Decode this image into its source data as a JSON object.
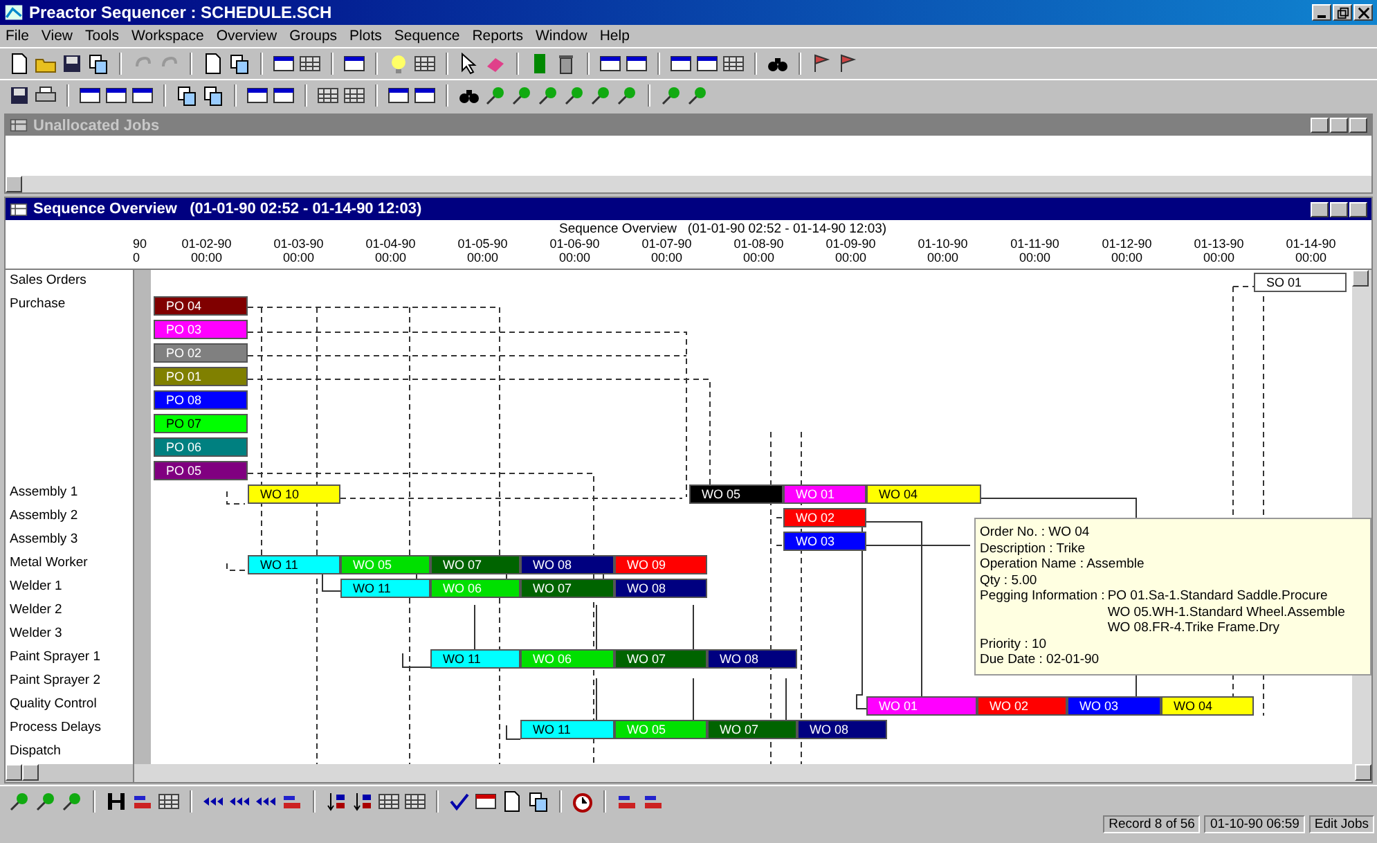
{
  "window": {
    "title": "Preactor Sequencer : SCHEDULE.SCH"
  },
  "menu": [
    "File",
    "View",
    "Tools",
    "Workspace",
    "Overview",
    "Groups",
    "Plots",
    "Sequence",
    "Reports",
    "Window",
    "Help"
  ],
  "unallocated": {
    "title": "Unallocated Jobs"
  },
  "overview": {
    "title": "Sequence Overview   (01-01-90 02:52 - 01-14-90 12:03)",
    "header": "Sequence Overview   (01-01-90 02:52 - 01-14-90 12:03)",
    "ticks": [
      {
        "date": "90",
        "time": "0"
      },
      {
        "date": "01-02-90",
        "time": "00:00"
      },
      {
        "date": "01-03-90",
        "time": "00:00"
      },
      {
        "date": "01-04-90",
        "time": "00:00"
      },
      {
        "date": "01-05-90",
        "time": "00:00"
      },
      {
        "date": "01-06-90",
        "time": "00:00"
      },
      {
        "date": "01-07-90",
        "time": "00:00"
      },
      {
        "date": "01-08-90",
        "time": "00:00"
      },
      {
        "date": "01-09-90",
        "time": "00:00"
      },
      {
        "date": "01-10-90",
        "time": "00:00"
      },
      {
        "date": "01-11-90",
        "time": "00:00"
      },
      {
        "date": "01-12-90",
        "time": "00:00"
      },
      {
        "date": "01-13-90",
        "time": "00:00"
      },
      {
        "date": "01-14-90",
        "time": "00:00"
      }
    ],
    "lanes": [
      {
        "label": "Sales Orders",
        "bars": [
          {
            "label": "SO 01",
            "color": "#ffffff"
          }
        ]
      },
      {
        "label": "Purchase",
        "bars": [
          {
            "label": "PO 04",
            "color": "#800000"
          },
          {
            "label": "PO 03",
            "color": "#ff00ff"
          },
          {
            "label": "PO 02",
            "color": "#808080"
          },
          {
            "label": "PO 01",
            "color": "#808000"
          },
          {
            "label": "PO 08",
            "color": "#0000ff"
          },
          {
            "label": "PO 07",
            "color": "#00ff00"
          },
          {
            "label": "PO 06",
            "color": "#008080"
          },
          {
            "label": "PO 05",
            "color": "#800080"
          }
        ]
      },
      {
        "label": "Assembly 1",
        "bars": [
          {
            "label": "WO 10",
            "color": "#ffff00"
          },
          {
            "label": "WO 05",
            "color": "#000000"
          },
          {
            "label": "WO 01",
            "color": "#ff00ff"
          },
          {
            "label": "WO 04",
            "color": "#ffff00"
          }
        ]
      },
      {
        "label": "Assembly 2",
        "bars": [
          {
            "label": "WO 02",
            "color": "#ff0000"
          }
        ]
      },
      {
        "label": "Assembly 3",
        "bars": [
          {
            "label": "WO 03",
            "color": "#0000ff"
          }
        ]
      },
      {
        "label": "Metal Worker",
        "bars": [
          {
            "label": "WO 11",
            "color": "#00ffff"
          },
          {
            "label": "WO 05",
            "color": "#00e000"
          },
          {
            "label": "WO 07",
            "color": "#006400"
          },
          {
            "label": "WO 08",
            "color": "#000080"
          },
          {
            "label": "WO 09",
            "color": "#ff0000"
          }
        ]
      },
      {
        "label": "Welder 1",
        "bars": [
          {
            "label": "WO 11",
            "color": "#00ffff"
          },
          {
            "label": "WO 06",
            "color": "#00e000"
          },
          {
            "label": "WO 07",
            "color": "#006400"
          },
          {
            "label": "WO 08",
            "color": "#000080"
          }
        ]
      },
      {
        "label": "Welder 2"
      },
      {
        "label": "Welder 3"
      },
      {
        "label": "Paint Sprayer 1",
        "bars": [
          {
            "label": "WO 11",
            "color": "#00ffff"
          },
          {
            "label": "WO 06",
            "color": "#00e000"
          },
          {
            "label": "WO 07",
            "color": "#006400"
          },
          {
            "label": "WO 08",
            "color": "#000080"
          }
        ]
      },
      {
        "label": "Paint Sprayer 2"
      },
      {
        "label": "Quality Control",
        "bars": [
          {
            "label": "WO 01",
            "color": "#ff00ff"
          },
          {
            "label": "WO 02",
            "color": "#ff0000"
          },
          {
            "label": "WO 03",
            "color": "#0000ff"
          },
          {
            "label": "WO 04",
            "color": "#ffff00"
          }
        ]
      },
      {
        "label": "Process Delays",
        "bars": [
          {
            "label": "WO 11",
            "color": "#00ffff"
          },
          {
            "label": "WO 05",
            "color": "#00e000"
          },
          {
            "label": "WO 07",
            "color": "#006400"
          },
          {
            "label": "WO 08",
            "color": "#000080"
          }
        ]
      },
      {
        "label": "Dispatch"
      }
    ],
    "tooltip": {
      "lines": [
        "Order No. : WO 04",
        "Description : Trike",
        "Operation Name : Assemble",
        "Qty : 5.00"
      ],
      "pegging_label": "Pegging Information :",
      "pegging": [
        "PO 01.Sa-1.Standard Saddle.Procure",
        "WO 05.WH-1.Standard Wheel.Assemble",
        "WO 08.FR-4.Trike Frame.Dry"
      ],
      "after": [
        "Priority : 10",
        "Due Date : 02-01-90"
      ]
    }
  },
  "status_bar": [
    "Record 8 of 56",
    "01-10-90 06:59",
    "Edit Jobs"
  ]
}
